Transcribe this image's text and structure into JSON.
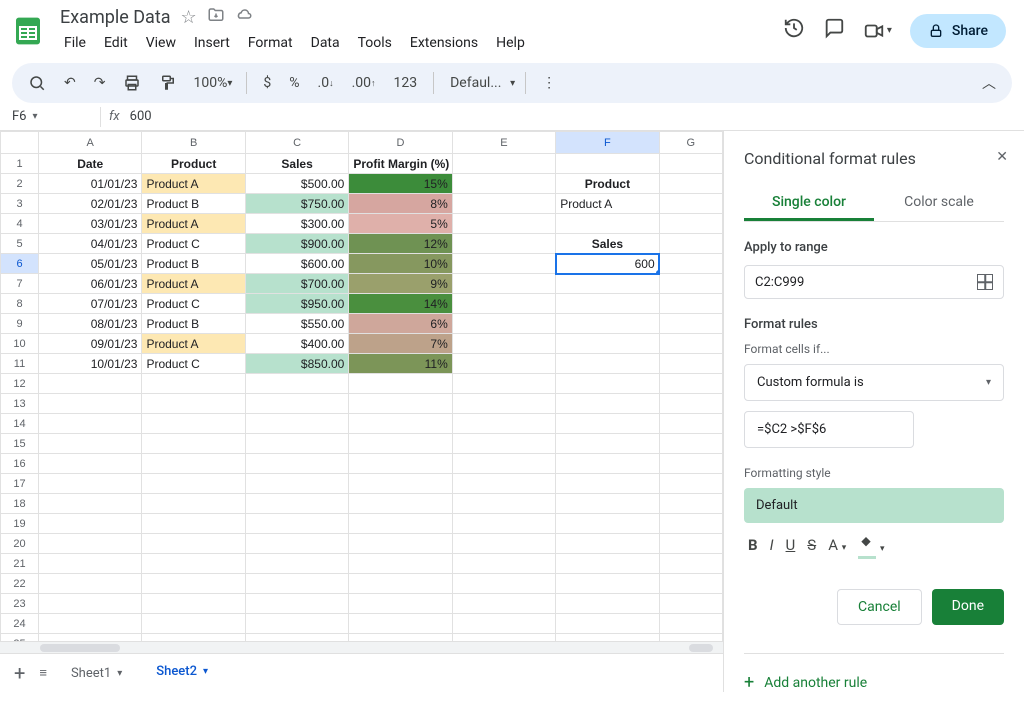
{
  "header": {
    "title": "Example Data",
    "menu": [
      "File",
      "Edit",
      "View",
      "Insert",
      "Format",
      "Data",
      "Tools",
      "Extensions",
      "Help"
    ],
    "share_label": "Share"
  },
  "toolbar": {
    "zoom": "100%",
    "font": "Defaul..."
  },
  "formula": {
    "name_box": "F6",
    "value": "600"
  },
  "columns": [
    "A",
    "B",
    "C",
    "D",
    "E",
    "F",
    "G"
  ],
  "headers": {
    "date": "Date",
    "product": "Product",
    "sales": "Sales",
    "pm": "Profit Margin (%)",
    "f_product": "Product",
    "f_sales": "Sales"
  },
  "rows": [
    {
      "date": "01/01/23",
      "product": "Product A",
      "sales": "$500.00",
      "pm": "15%",
      "pm_color": "#3c8c3a",
      "pA": true,
      "hi": false
    },
    {
      "date": "02/01/23",
      "product": "Product B",
      "sales": "$750.00",
      "pm": "8%",
      "pm_color": "#d6a6a0",
      "pA": false,
      "hi": true
    },
    {
      "date": "03/01/23",
      "product": "Product A",
      "sales": "$300.00",
      "pm": "5%",
      "pm_color": "#dfb0aa",
      "pA": true,
      "hi": false
    },
    {
      "date": "04/01/23",
      "product": "Product C",
      "sales": "$900.00",
      "pm": "12%",
      "pm_color": "#6f9253",
      "pA": false,
      "hi": true
    },
    {
      "date": "05/01/23",
      "product": "Product B",
      "sales": "$600.00",
      "pm": "10%",
      "pm_color": "#86985f",
      "pA": false,
      "hi": false
    },
    {
      "date": "06/01/23",
      "product": "Product A",
      "sales": "$700.00",
      "pm": "9%",
      "pm_color": "#9aa06c",
      "pA": true,
      "hi": true
    },
    {
      "date": "07/01/23",
      "product": "Product C",
      "sales": "$950.00",
      "pm": "14%",
      "pm_color": "#4a8f3e",
      "pA": false,
      "hi": true
    },
    {
      "date": "08/01/23",
      "product": "Product B",
      "sales": "$550.00",
      "pm": "6%",
      "pm_color": "#cfa79b",
      "pA": false,
      "hi": false
    },
    {
      "date": "09/01/23",
      "product": "Product A",
      "sales": "$400.00",
      "pm": "7%",
      "pm_color": "#bda28a",
      "pA": true,
      "hi": false
    },
    {
      "date": "10/01/23",
      "product": "Product C",
      "sales": "$850.00",
      "pm": "11%",
      "pm_color": "#7c9558",
      "pA": false,
      "hi": true
    }
  ],
  "sideF": {
    "product_val": "Product A",
    "sales_val": "600"
  },
  "tabs": {
    "sheet1": "Sheet1",
    "sheet2": "Sheet2"
  },
  "panel": {
    "title": "Conditional format rules",
    "tab_single": "Single color",
    "tab_scale": "Color scale",
    "apply_label": "Apply to range",
    "range": "C2:C999",
    "rules_label": "Format rules",
    "cells_if": "Format cells if...",
    "condition": "Custom formula is",
    "formula": "=$C2 >$F$6",
    "style_label": "Formatting style",
    "style_name": "Default",
    "cancel": "Cancel",
    "done": "Done",
    "add_rule": "Add another rule"
  }
}
